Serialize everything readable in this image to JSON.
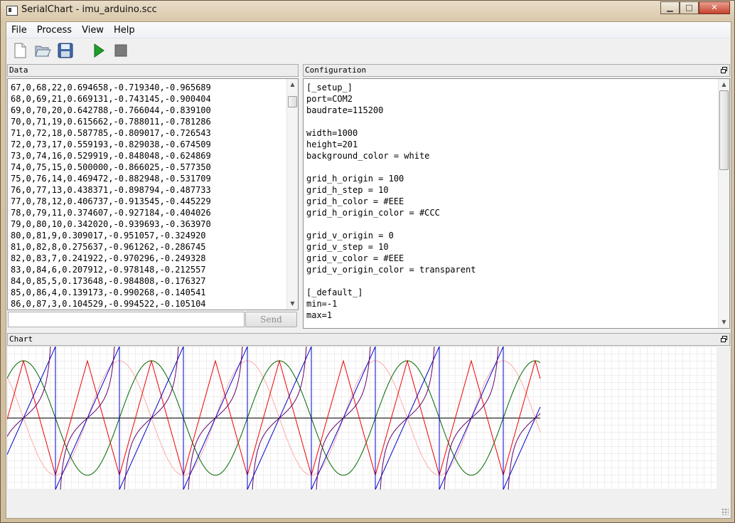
{
  "window": {
    "title": "SerialChart - imu_arduino.scc",
    "minimize_glyph": "▁",
    "maximize_glyph": "□",
    "close_glyph": "✕"
  },
  "menu": {
    "items": [
      {
        "label": "File"
      },
      {
        "label": "Process"
      },
      {
        "label": "View"
      },
      {
        "label": "Help"
      }
    ]
  },
  "toolbar": {
    "buttons": [
      {
        "icon": "new-file-icon"
      },
      {
        "icon": "open-folder-icon"
      },
      {
        "icon": "save-icon"
      },
      {
        "icon": "play-icon",
        "color": "#1e9e2a"
      },
      {
        "icon": "stop-icon",
        "color": "#7a7a7a"
      }
    ]
  },
  "data_panel": {
    "title": "Data",
    "lines": [
      "67,0,68,22,0.694658,-0.719340,-0.965689",
      "68,0,69,21,0.669131,-0.743145,-0.900404",
      "69,0,70,20,0.642788,-0.766044,-0.839100",
      "70,0,71,19,0.615662,-0.788011,-0.781286",
      "71,0,72,18,0.587785,-0.809017,-0.726543",
      "72,0,73,17,0.559193,-0.829038,-0.674509",
      "73,0,74,16,0.529919,-0.848048,-0.624869",
      "74,0,75,15,0.500000,-0.866025,-0.577350",
      "75,0,76,14,0.469472,-0.882948,-0.531709",
      "76,0,77,13,0.438371,-0.898794,-0.487733",
      "77,0,78,12,0.406737,-0.913545,-0.445229",
      "78,0,79,11,0.374607,-0.927184,-0.404026",
      "79,0,80,10,0.342020,-0.939693,-0.363970",
      "80,0,81,9,0.309017,-0.951057,-0.324920",
      "81,0,82,8,0.275637,-0.961262,-0.286745",
      "82,0,83,7,0.241922,-0.970296,-0.249328",
      "83,0,84,6,0.207912,-0.978148,-0.212557",
      "84,0,85,5,0.173648,-0.984808,-0.176327",
      "85,0,86,4,0.139173,-0.990268,-0.140541",
      "86,0,87,3,0.104529,-0.994522,-0.105104"
    ],
    "send_input_value": "",
    "send_label": "Send",
    "scroll_position": 0.03
  },
  "config_panel": {
    "title": "Configuration",
    "lines": [
      "[_setup_]",
      "port=COM2",
      "baudrate=115200",
      "",
      "width=1000",
      "height=201",
      "background_color = white",
      "",
      "grid_h_origin = 100",
      "grid_h_step = 10",
      "grid_h_color = #EEE",
      "grid_h_origin_color = #CCC",
      "",
      "grid_v_origin = 0",
      "grid_v_step = 10",
      "grid_v_color = #EEE",
      "grid_v_origin_color = transparent",
      "",
      "[_default_]",
      "min=-1",
      "max=1"
    ],
    "scroll_position": 0.0
  },
  "chart_panel": {
    "title": "Chart"
  },
  "chart_data": {
    "type": "line",
    "x_range": [
      0,
      750
    ],
    "ylim": [
      -1,
      1
    ],
    "grid": true,
    "grid_color": "#EEEEEE",
    "axis_color": "#000000",
    "series": [
      {
        "color": "#0000cc",
        "kind": "sawtooth",
        "period": 90,
        "phase": 22,
        "amplitude": 1.0
      },
      {
        "color": "#ee0000",
        "kind": "triangle",
        "period": 90,
        "phase": 22,
        "amplitude": 0.8
      },
      {
        "color": "#006600",
        "kind": "sine",
        "period": 180,
        "phase": 22,
        "amplitude": 0.8
      },
      {
        "color": "#ffaaaa",
        "kind": "cosine",
        "period": 180,
        "phase": 22,
        "amplitude": 0.8
      },
      {
        "color": "#660066",
        "kind": "tangent",
        "period": 90,
        "phase": 22,
        "amplitude": 1.0
      }
    ]
  }
}
